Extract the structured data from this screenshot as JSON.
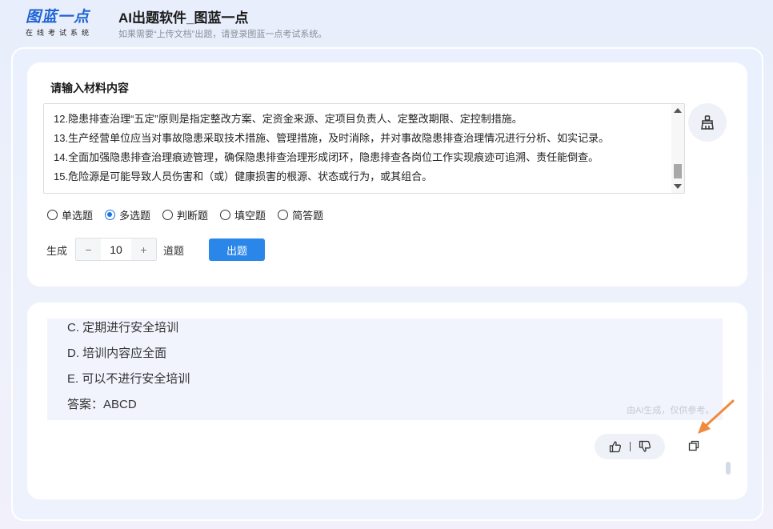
{
  "header": {
    "logo_main": "图蓝一点",
    "logo_sub": "在线考试系统",
    "title": "AI出题软件_图蓝一点",
    "subtitle": "如果需要“上传文档”出题，请登录图蓝一点考试系统。"
  },
  "input_section": {
    "label": "请输入材料内容",
    "text_lines": [
      "12.隐患排查治理“五定”原则是指定整改方案、定资金来源、定项目负责人、定整改期限、定控制措施。",
      "13.生产经营单位应当对事故隐患采取技术措施、管理措施，及时消除，并对事故隐患排查治理情况进行分析、如实记录。",
      "14.全面加强隐患排查治理痕迹管理，确保隐患排查治理形成闭环，隐患排查各岗位工作实现痕迹可追溯、责任能倒查。",
      "15.危险源是可能导致人员伤害和（或）健康损害的根源、状态或行为，或其组合。"
    ],
    "clear_icon": "broom-icon"
  },
  "question_types": {
    "options": [
      "单选题",
      "多选题",
      "判断题",
      "填空题",
      "简答题"
    ],
    "selected": "多选题"
  },
  "generate": {
    "prefix_label": "生成",
    "minus": "−",
    "count": "10",
    "plus": "+",
    "suffix_label": "道题",
    "submit_label": "出题"
  },
  "result": {
    "lines": [
      "C. 定期进行安全培训",
      "D. 培训内容应全面",
      "E. 可以不进行安全培训",
      "答案：ABCD"
    ],
    "disclaimer": "由AI生成，仅供参考。",
    "like_icon": "thumbs-up-icon",
    "dislike_icon": "thumbs-down-icon",
    "copy_icon": "copy-icon"
  },
  "colors": {
    "accent": "#2a86e8",
    "logo": "#1f63d6",
    "annotation_arrow": "#f08a3c"
  }
}
